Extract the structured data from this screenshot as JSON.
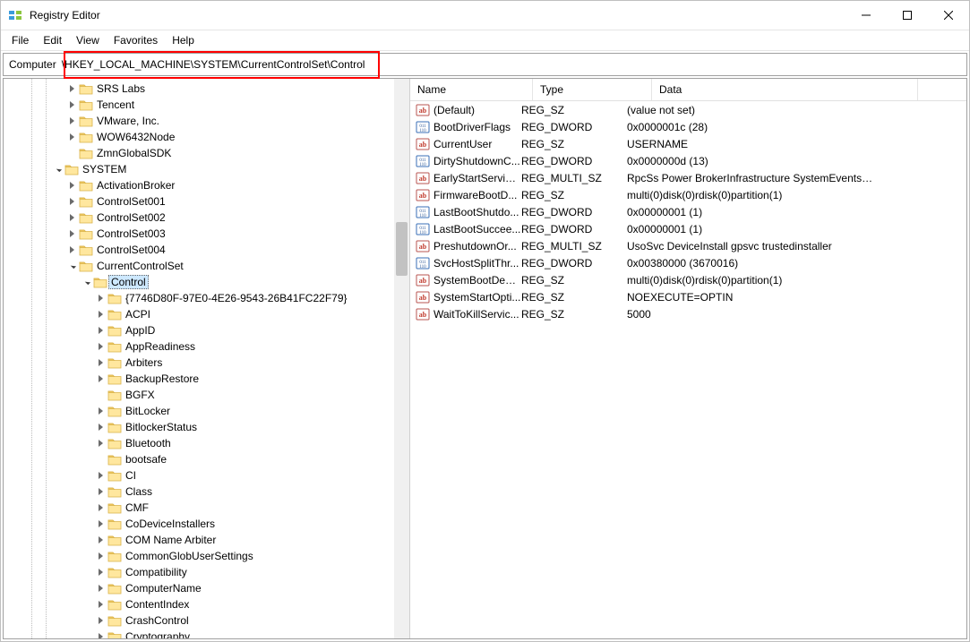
{
  "title": "Registry Editor",
  "menus": [
    "File",
    "Edit",
    "View",
    "Favorites",
    "Help"
  ],
  "address_label": "Computer",
  "address_path": "\\HKEY_LOCAL_MACHINE\\SYSTEM\\CurrentControlSet\\Control",
  "tree": [
    {
      "indent": 3,
      "exp": "collapsed",
      "label": "SRS Labs"
    },
    {
      "indent": 3,
      "exp": "collapsed",
      "label": "Tencent"
    },
    {
      "indent": 3,
      "exp": "collapsed",
      "label": "VMware, Inc."
    },
    {
      "indent": 3,
      "exp": "collapsed",
      "label": "WOW6432Node"
    },
    {
      "indent": 3,
      "exp": "none",
      "label": "ZmnGlobalSDK"
    },
    {
      "indent": 2,
      "exp": "expanded",
      "label": "SYSTEM"
    },
    {
      "indent": 3,
      "exp": "collapsed",
      "label": "ActivationBroker"
    },
    {
      "indent": 3,
      "exp": "collapsed",
      "label": "ControlSet001"
    },
    {
      "indent": 3,
      "exp": "collapsed",
      "label": "ControlSet002"
    },
    {
      "indent": 3,
      "exp": "collapsed",
      "label": "ControlSet003"
    },
    {
      "indent": 3,
      "exp": "collapsed",
      "label": "ControlSet004"
    },
    {
      "indent": 3,
      "exp": "expanded",
      "label": "CurrentControlSet"
    },
    {
      "indent": 4,
      "exp": "expanded",
      "label": "Control",
      "selected": true
    },
    {
      "indent": 5,
      "exp": "collapsed",
      "label": "{7746D80F-97E0-4E26-9543-26B41FC22F79}"
    },
    {
      "indent": 5,
      "exp": "collapsed",
      "label": "ACPI"
    },
    {
      "indent": 5,
      "exp": "collapsed",
      "label": "AppID"
    },
    {
      "indent": 5,
      "exp": "collapsed",
      "label": "AppReadiness"
    },
    {
      "indent": 5,
      "exp": "collapsed",
      "label": "Arbiters"
    },
    {
      "indent": 5,
      "exp": "collapsed",
      "label": "BackupRestore"
    },
    {
      "indent": 5,
      "exp": "none",
      "label": "BGFX"
    },
    {
      "indent": 5,
      "exp": "collapsed",
      "label": "BitLocker"
    },
    {
      "indent": 5,
      "exp": "collapsed",
      "label": "BitlockerStatus"
    },
    {
      "indent": 5,
      "exp": "collapsed",
      "label": "Bluetooth"
    },
    {
      "indent": 5,
      "exp": "none",
      "label": "bootsafe"
    },
    {
      "indent": 5,
      "exp": "collapsed",
      "label": "CI"
    },
    {
      "indent": 5,
      "exp": "collapsed",
      "label": "Class"
    },
    {
      "indent": 5,
      "exp": "collapsed",
      "label": "CMF"
    },
    {
      "indent": 5,
      "exp": "collapsed",
      "label": "CoDeviceInstallers"
    },
    {
      "indent": 5,
      "exp": "collapsed",
      "label": "COM Name Arbiter"
    },
    {
      "indent": 5,
      "exp": "collapsed",
      "label": "CommonGlobUserSettings"
    },
    {
      "indent": 5,
      "exp": "collapsed",
      "label": "Compatibility"
    },
    {
      "indent": 5,
      "exp": "collapsed",
      "label": "ComputerName"
    },
    {
      "indent": 5,
      "exp": "collapsed",
      "label": "ContentIndex"
    },
    {
      "indent": 5,
      "exp": "collapsed",
      "label": "CrashControl"
    },
    {
      "indent": 5,
      "exp": "collapsed",
      "label": "Cryptography"
    }
  ],
  "columns": {
    "name": "Name",
    "type": "Type",
    "data": "Data"
  },
  "values": [
    {
      "icon": "sz",
      "name": "(Default)",
      "type": "REG_SZ",
      "data": "(value not set)"
    },
    {
      "icon": "bin",
      "name": "BootDriverFlags",
      "type": "REG_DWORD",
      "data": "0x0000001c (28)"
    },
    {
      "icon": "sz",
      "name": "CurrentUser",
      "type": "REG_SZ",
      "data": "USERNAME"
    },
    {
      "icon": "bin",
      "name": "DirtyShutdownC...",
      "type": "REG_DWORD",
      "data": "0x0000000d (13)"
    },
    {
      "icon": "sz",
      "name": "EarlyStartServices",
      "type": "REG_MULTI_SZ",
      "data": "RpcSs Power BrokerInfrastructure SystemEventsBr..."
    },
    {
      "icon": "sz",
      "name": "FirmwareBootD...",
      "type": "REG_SZ",
      "data": "multi(0)disk(0)rdisk(0)partition(1)"
    },
    {
      "icon": "bin",
      "name": "LastBootShutdo...",
      "type": "REG_DWORD",
      "data": "0x00000001 (1)"
    },
    {
      "icon": "bin",
      "name": "LastBootSuccee...",
      "type": "REG_DWORD",
      "data": "0x00000001 (1)"
    },
    {
      "icon": "sz",
      "name": "PreshutdownOr...",
      "type": "REG_MULTI_SZ",
      "data": "UsoSvc DeviceInstall gpsvc trustedinstaller"
    },
    {
      "icon": "bin",
      "name": "SvcHostSplitThr...",
      "type": "REG_DWORD",
      "data": "0x00380000 (3670016)"
    },
    {
      "icon": "sz",
      "name": "SystemBootDevi...",
      "type": "REG_SZ",
      "data": "multi(0)disk(0)rdisk(0)partition(1)"
    },
    {
      "icon": "sz",
      "name": "SystemStartOpti...",
      "type": "REG_SZ",
      "data": " NOEXECUTE=OPTIN"
    },
    {
      "icon": "sz",
      "name": "WaitToKillServic...",
      "type": "REG_SZ",
      "data": "5000"
    }
  ]
}
